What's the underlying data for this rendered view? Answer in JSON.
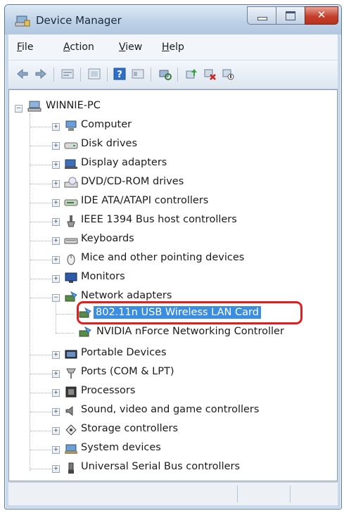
{
  "window": {
    "title": "Device Manager"
  },
  "menubar": {
    "items": [
      {
        "label": "File"
      },
      {
        "label": "Action"
      },
      {
        "label": "View"
      },
      {
        "label": "Help"
      }
    ]
  },
  "tree": {
    "root": "WINNIE-PC",
    "categories": [
      {
        "label": "Computer",
        "icon": "computer-icon",
        "expanded": false
      },
      {
        "label": "Disk drives",
        "icon": "disk-drive-icon",
        "expanded": false
      },
      {
        "label": "Display adapters",
        "icon": "display-adapter-icon",
        "expanded": false
      },
      {
        "label": "DVD/CD-ROM drives",
        "icon": "dvd-drive-icon",
        "expanded": false
      },
      {
        "label": "IDE ATA/ATAPI controllers",
        "icon": "ide-controller-icon",
        "expanded": false
      },
      {
        "label": "IEEE 1394 Bus host controllers",
        "icon": "ieee1394-icon",
        "expanded": false
      },
      {
        "label": "Keyboards",
        "icon": "keyboard-icon",
        "expanded": false
      },
      {
        "label": "Mice and other pointing devices",
        "icon": "mouse-icon",
        "expanded": false
      },
      {
        "label": "Monitors",
        "icon": "monitor-icon",
        "expanded": false
      },
      {
        "label": "Network adapters",
        "icon": "network-adapter-icon",
        "expanded": true,
        "children": [
          {
            "label": "802.11n USB Wireless LAN Card",
            "selected": true
          },
          {
            "label": "NVIDIA nForce Networking Controller",
            "selected": false
          }
        ]
      },
      {
        "label": "Portable Devices",
        "icon": "portable-device-icon",
        "expanded": false
      },
      {
        "label": "Ports (COM & LPT)",
        "icon": "port-icon",
        "expanded": false
      },
      {
        "label": "Processors",
        "icon": "processor-icon",
        "expanded": false
      },
      {
        "label": "Sound, video and game controllers",
        "icon": "speaker-icon",
        "expanded": false
      },
      {
        "label": "Storage controllers",
        "icon": "storage-controller-icon",
        "expanded": false
      },
      {
        "label": "System devices",
        "icon": "system-device-icon",
        "expanded": false
      },
      {
        "label": "Universal Serial Bus controllers",
        "icon": "usb-icon",
        "expanded": false
      }
    ]
  },
  "colors": {
    "selection": "#3b8de0",
    "highlight_ring": "#e02020"
  }
}
